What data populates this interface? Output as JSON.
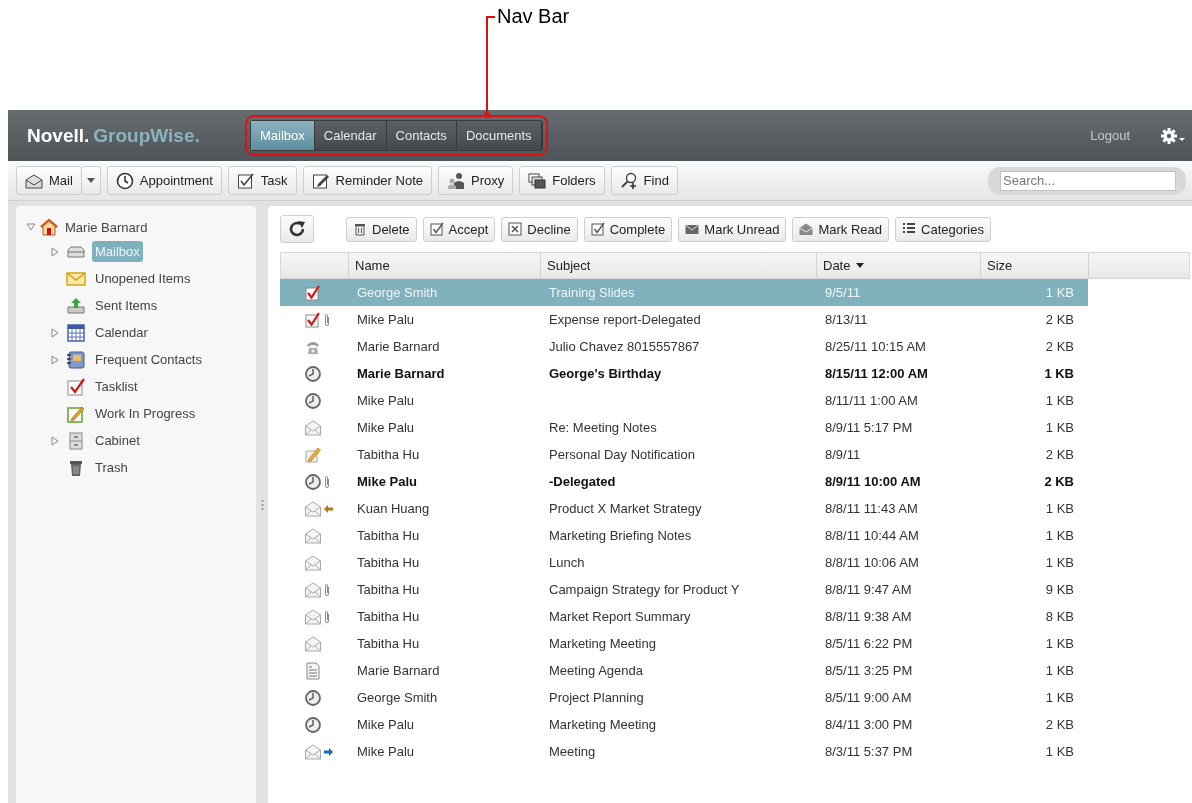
{
  "annotation": {
    "label": "Nav Bar"
  },
  "header": {
    "logo": {
      "brand": "Novell.",
      "product": "GroupWise."
    },
    "nav_tabs": [
      {
        "label": "Mailbox",
        "selected": true
      },
      {
        "label": "Calendar",
        "selected": false
      },
      {
        "label": "Contacts",
        "selected": false
      },
      {
        "label": "Documents",
        "selected": false
      }
    ],
    "logout": "Logout"
  },
  "toolbar": {
    "buttons": [
      {
        "kind": "mail",
        "label": "Mail",
        "dropdown": true
      },
      {
        "kind": "appointment",
        "label": "Appointment",
        "dropdown": false
      },
      {
        "kind": "task",
        "label": "Task",
        "dropdown": false
      },
      {
        "kind": "reminder",
        "label": "Reminder Note",
        "dropdown": false
      },
      {
        "kind": "proxy",
        "label": "Proxy",
        "dropdown": false
      },
      {
        "kind": "folders",
        "label": "Folders",
        "dropdown": false
      },
      {
        "kind": "find",
        "label": "Find",
        "dropdown": false
      }
    ],
    "search": {
      "placeholder": "Search..."
    }
  },
  "sidebar": {
    "root": {
      "label": "Marie Barnard",
      "expanded": true,
      "children": [
        {
          "kind": "mailbox",
          "label": "Mailbox",
          "selected": true,
          "expandable": true
        },
        {
          "kind": "unopened",
          "label": "Unopened Items",
          "selected": false,
          "expandable": false
        },
        {
          "kind": "sent",
          "label": "Sent Items",
          "selected": false,
          "expandable": false
        },
        {
          "kind": "calendar",
          "label": "Calendar",
          "selected": false,
          "expandable": true
        },
        {
          "kind": "contacts",
          "label": "Frequent Contacts",
          "selected": false,
          "expandable": true
        },
        {
          "kind": "tasklist",
          "label": "Tasklist",
          "selected": false,
          "expandable": false
        },
        {
          "kind": "progress",
          "label": "Work In Progress",
          "selected": false,
          "expandable": false
        },
        {
          "kind": "cabinet",
          "label": "Cabinet",
          "selected": false,
          "expandable": true
        },
        {
          "kind": "trash",
          "label": "Trash",
          "selected": false,
          "expandable": false
        }
      ]
    }
  },
  "actions": [
    {
      "kind": "delete",
      "label": "Delete"
    },
    {
      "kind": "accept",
      "label": "Accept"
    },
    {
      "kind": "decline",
      "label": "Decline"
    },
    {
      "kind": "complete",
      "label": "Complete"
    },
    {
      "kind": "unread",
      "label": "Mark Unread"
    },
    {
      "kind": "read",
      "label": "Mark Read"
    },
    {
      "kind": "categories",
      "label": "Categories"
    }
  ],
  "table": {
    "columns": [
      {
        "label": "Name",
        "sorted": false
      },
      {
        "label": "Subject",
        "sorted": false
      },
      {
        "label": "Date",
        "sorted": true
      },
      {
        "label": "Size",
        "sorted": false
      }
    ],
    "rows": [
      {
        "kind": "task",
        "attachment": false,
        "unread": false,
        "selected": true,
        "name": "George Smith",
        "subject": "Training Slides",
        "date": "9/5/11",
        "size": "1 KB"
      },
      {
        "kind": "task",
        "attachment": true,
        "unread": false,
        "selected": false,
        "name": "Mike Palu",
        "subject": "Expense report-Delegated",
        "date": "8/13/11",
        "size": "2 KB"
      },
      {
        "kind": "phone",
        "attachment": false,
        "unread": false,
        "selected": false,
        "name": "Marie Barnard",
        "subject": "Julio Chavez 8015557867",
        "date": "8/25/11 10:15 AM",
        "size": "2 KB"
      },
      {
        "kind": "appointment",
        "attachment": false,
        "unread": true,
        "selected": false,
        "name": "Marie Barnard",
        "subject": "George's Birthday",
        "date": "8/15/11 12:00 AM",
        "size": "1 KB"
      },
      {
        "kind": "appointment",
        "attachment": false,
        "unread": false,
        "selected": false,
        "name": "Mike Palu",
        "date": "8/11/11 1:00 AM",
        "size": "1 KB"
      },
      {
        "kind": "mail",
        "attachment": false,
        "unread": false,
        "selected": false,
        "name": "Mike Palu",
        "subject": "Re: Meeting Notes",
        "date": "8/9/11 5:17 PM",
        "size": "1 KB"
      },
      {
        "kind": "note",
        "attachment": false,
        "unread": false,
        "selected": false,
        "name": "Tabitha Hu",
        "subject": "Personal Day Notification",
        "date": "8/9/11",
        "size": "2 KB"
      },
      {
        "kind": "appointment",
        "attachment": true,
        "unread": true,
        "selected": false,
        "name": "Mike Palu",
        "subject": "-Delegated",
        "date": "8/9/11 10:00 AM",
        "size": "2 KB"
      },
      {
        "kind": "mail",
        "replied": true,
        "forwarded": false,
        "attachment": false,
        "unread": false,
        "selected": false,
        "name": "Kuan Huang",
        "subject": "Product X Market Strategy",
        "date": "8/8/11 11:43 AM",
        "size": "1 KB"
      },
      {
        "kind": "mail",
        "attachment": false,
        "unread": false,
        "selected": false,
        "name": "Tabitha Hu",
        "subject": "Marketing Briefing Notes",
        "date": "8/8/11 10:44 AM",
        "size": "1 KB"
      },
      {
        "kind": "mail",
        "attachment": false,
        "unread": false,
        "selected": false,
        "name": "Tabitha Hu",
        "subject": "Lunch",
        "date": "8/8/11 10:06 AM",
        "size": "1 KB"
      },
      {
        "kind": "mail",
        "attachment": true,
        "unread": false,
        "selected": false,
        "name": "Tabitha Hu",
        "subject": "Campaign Strategy for Product Y",
        "date": "8/8/11 9:47 AM",
        "size": "9 KB"
      },
      {
        "kind": "mail",
        "attachment": true,
        "unread": false,
        "selected": false,
        "name": "Tabitha Hu",
        "subject": "Market Report Summary",
        "date": "8/8/11 9:38 AM",
        "size": "8 KB"
      },
      {
        "kind": "mail",
        "attachment": false,
        "unread": false,
        "selected": false,
        "name": "Tabitha Hu",
        "subject": "Marketing Meeting",
        "date": "8/5/11 6:22 PM",
        "size": "1 KB"
      },
      {
        "kind": "document",
        "attachment": false,
        "unread": false,
        "selected": false,
        "name": "Marie Barnard",
        "subject": "Meeting Agenda",
        "date": "8/5/11 3:25 PM",
        "size": "1 KB"
      },
      {
        "kind": "appointment",
        "attachment": false,
        "unread": false,
        "selected": false,
        "name": "George Smith",
        "subject": "Project Planning",
        "date": "8/5/11 9:00 AM",
        "size": "1 KB"
      },
      {
        "kind": "appointment",
        "attachment": false,
        "unread": false,
        "selected": false,
        "name": "Mike Palu",
        "subject": "Marketing Meeting",
        "date": "8/4/11 3:00 PM",
        "size": "2 KB"
      },
      {
        "kind": "mail",
        "replied": false,
        "forwarded": true,
        "attachment": false,
        "unread": false,
        "selected": false,
        "name": "Mike Palu",
        "subject": "Meeting",
        "date": "8/3/11 5:37 PM",
        "size": "1 KB"
      }
    ]
  }
}
